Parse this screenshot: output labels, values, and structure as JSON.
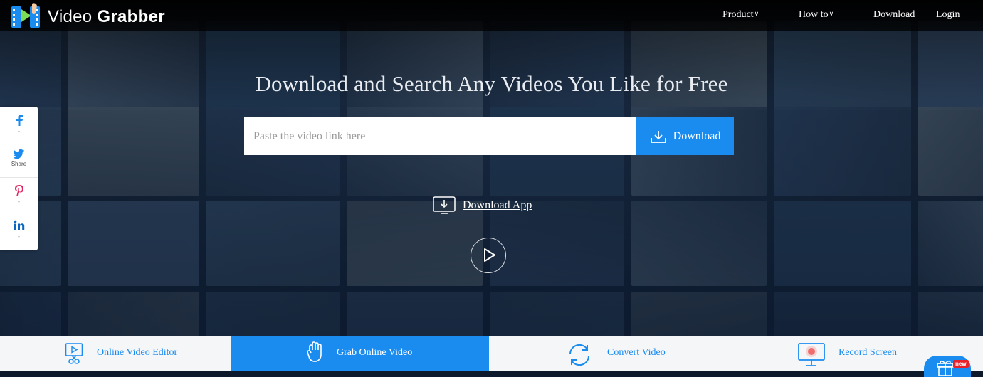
{
  "brand": {
    "word1": "Video",
    "word2": "Grabber"
  },
  "nav": {
    "product": "Product",
    "how_to": "How to",
    "download": "Download",
    "login": "Login"
  },
  "hero": {
    "headline": "Download and Search Any Videos You Like for Free",
    "search_placeholder": "Paste the video link here",
    "search_value": "",
    "download_button": "Download",
    "download_app": "Download App"
  },
  "share": [
    {
      "icon": "facebook-icon",
      "label": "-"
    },
    {
      "icon": "twitter-icon",
      "label": "Share"
    },
    {
      "icon": "pinterest-icon",
      "label": "-"
    },
    {
      "icon": "linkedin-icon",
      "label": "-"
    }
  ],
  "features": [
    {
      "label": "Online Video Editor",
      "icon": "video-editor-icon",
      "active": false
    },
    {
      "label": "Grab Online Video",
      "icon": "grab-hand-icon",
      "active": true
    },
    {
      "label": "Convert Video",
      "icon": "convert-icon",
      "active": false
    },
    {
      "label": "Record Screen",
      "icon": "record-screen-icon",
      "active": false
    }
  ],
  "badge": "new",
  "colors": {
    "accent": "#1a8cf0",
    "topbar": "#000000",
    "badge": "#e8212b"
  }
}
